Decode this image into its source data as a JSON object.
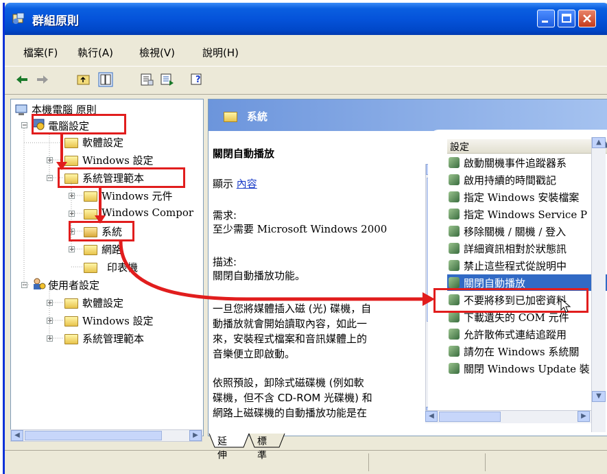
{
  "window": {
    "title": "群組原則"
  },
  "menu": [
    "檔案(F)",
    "執行(A)",
    "檢視(V)",
    "說明(H)"
  ],
  "toolbar": {
    "icons": [
      "back-icon",
      "forward-icon",
      "up-folder-icon",
      "show-hide-tree-icon",
      "properties-icon",
      "export-list-icon",
      "help-icon"
    ]
  },
  "tree": {
    "root": "本機電腦 原則",
    "computer_config": "電腦設定",
    "software_settings": "軟體設定",
    "windows_settings": "Windows 設定",
    "admin_templates": "系統管理範本",
    "windows_components": "Windows 元件",
    "windows_components2": "Windows Compor",
    "system": "系統",
    "network": "網路",
    "printers": "印表機",
    "user_config": "使用者設定",
    "user_software": "軟體設定",
    "user_windows": "Windows 設定",
    "user_admin": "系統管理範本"
  },
  "right": {
    "header": "系統",
    "policy_title": "關閉自動播放",
    "display_prefix": "顯示",
    "display_link": "內容",
    "req_label": "需求:",
    "req_value": "至少需要 Microsoft Windows 2000",
    "desc_label": "描述:",
    "desc_value": "關閉自動播放功能。",
    "para1": [
      "一旦您將媒體插入磁 (光) 碟機，自",
      "動播放就會開始讀取內容，如此一",
      "來，安裝程式檔案和音訊媒體上的",
      "音樂便立即啟動。"
    ],
    "para2": [
      "依照預設，卸除式磁碟機 (例如軟",
      "碟機，但不含 CD-ROM 光碟機) 和",
      "網路上磁碟機的自動播放功能是在"
    ]
  },
  "settings": {
    "header": "設定",
    "rows": [
      "啟動關機事件追蹤器系",
      "啟用持續的時間戳記",
      "指定 Windows 安裝檔案",
      "指定 Windows Service P",
      "移除關機 / 關機 / 登入",
      "詳細資訊相對於狀態訊",
      "禁止這些程式從說明中",
      "關閉自動播放",
      "不要將移到已加密資料",
      "下載遺失的 COM 元件",
      "允許散佈式連結追蹤用",
      "請勿在 Windows 系統關",
      "關閉 Windows Update 裝"
    ],
    "selected_index": 7
  },
  "tabs": [
    "延伸",
    "標準"
  ],
  "colors": {
    "highlight": "#e11d1d",
    "selection": "#316ac5",
    "titlebar": "#0553da"
  }
}
